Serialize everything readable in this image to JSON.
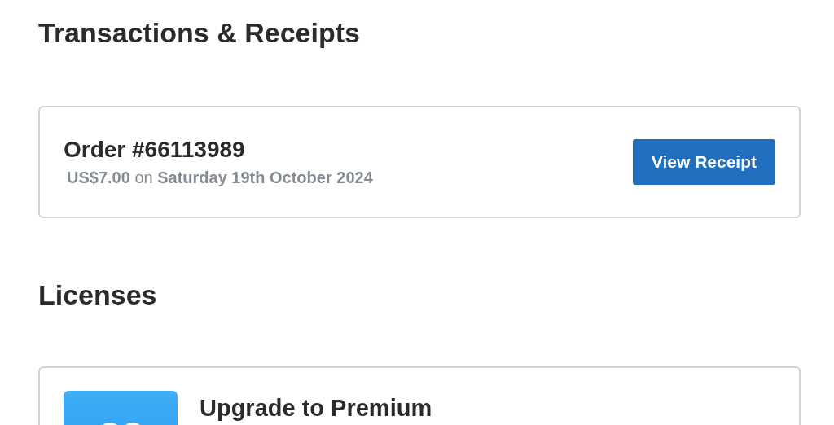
{
  "transactions": {
    "heading": "Transactions & Receipts",
    "orders": [
      {
        "title": "Order #66113989",
        "summary": "**US$7.00** on **Saturday 19th October 2024**",
        "button": "View Receipt"
      }
    ]
  },
  "licenses": {
    "heading": "Licenses",
    "items": [
      {
        "title": "Upgrade to Premium"
      }
    ]
  }
}
